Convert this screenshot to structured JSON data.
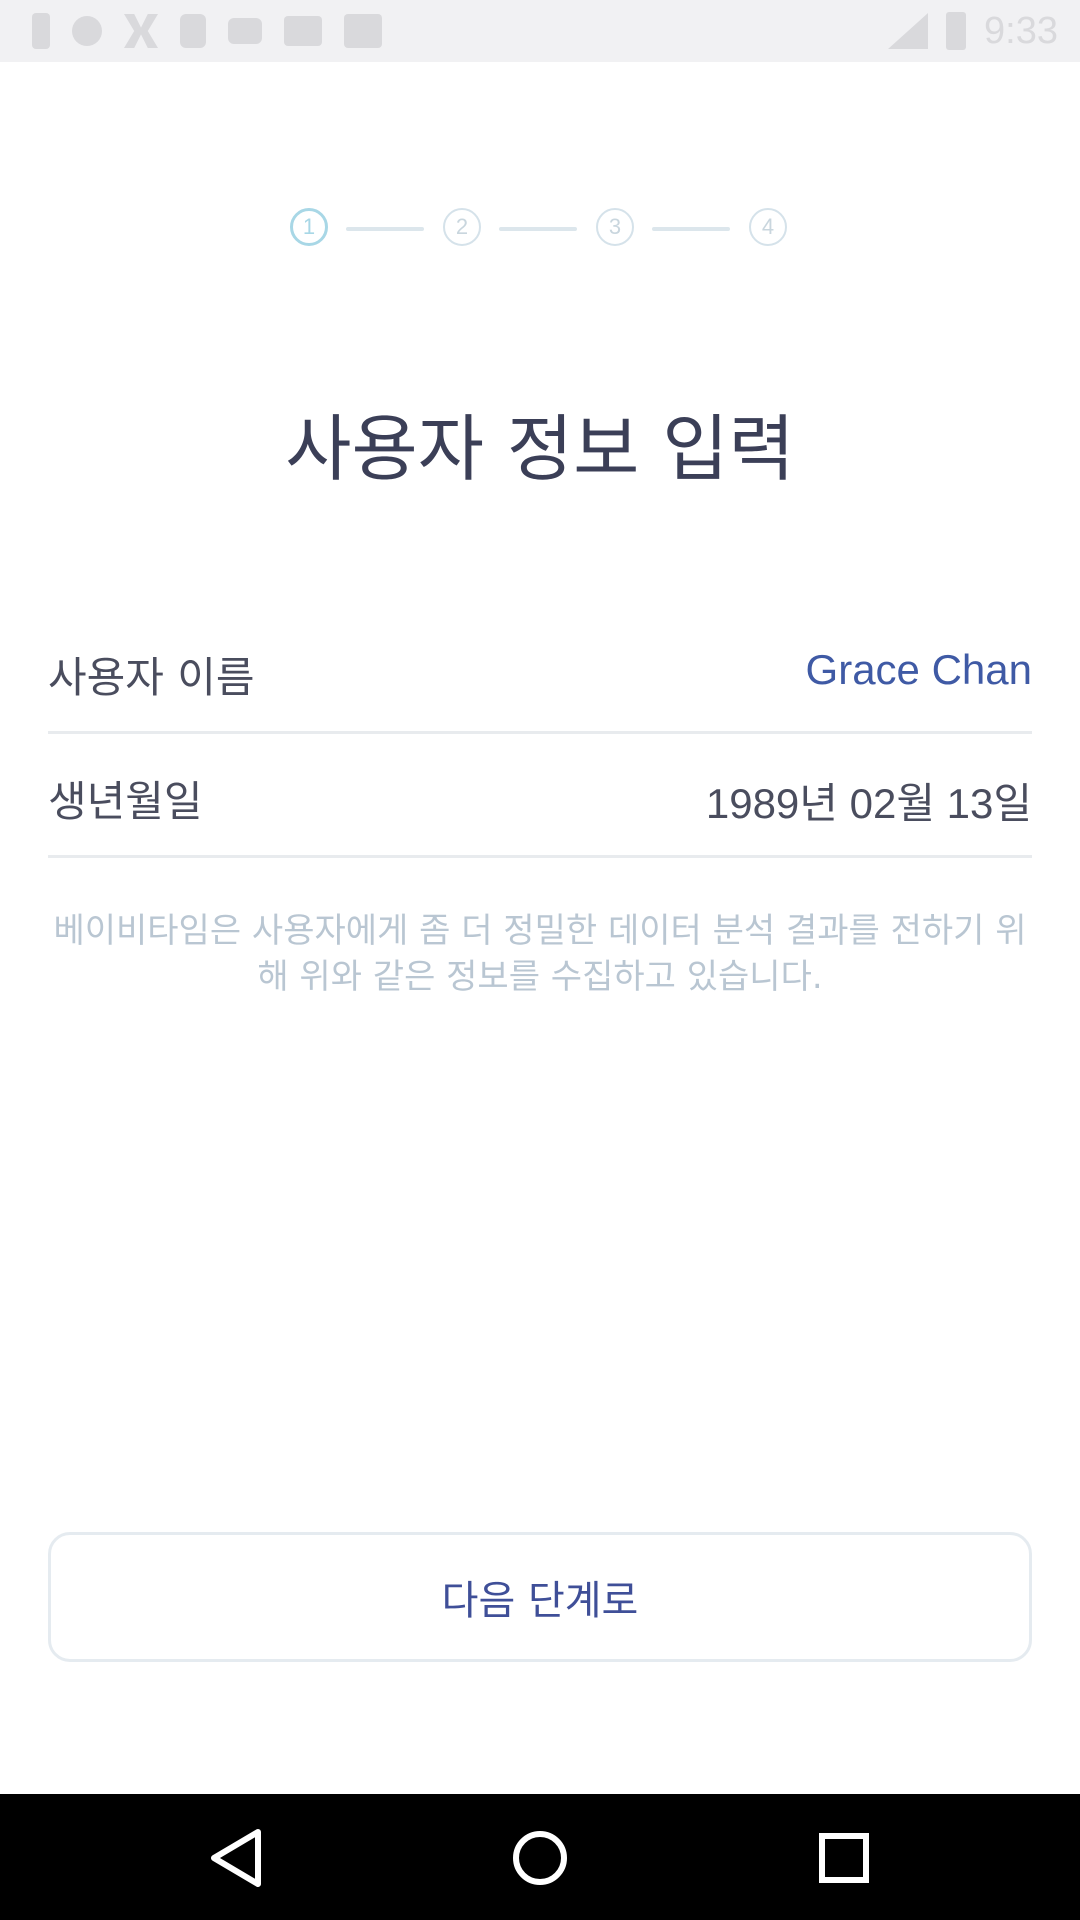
{
  "status_bar": {
    "time": "9:33"
  },
  "stepper": {
    "steps": [
      "1",
      "2",
      "3",
      "4"
    ],
    "active_step": 1
  },
  "page": {
    "title": "사용자 정보 입력"
  },
  "form": {
    "name_label": "사용자 이름",
    "name_value": "Grace Chan",
    "birth_label": "생년월일",
    "birth_value": "1989년 02월 13일"
  },
  "notice": {
    "text": "베이비타임은 사용자에게 좀 더 정밀한 데이터 분석 결과를 전하기 위해 위와 같은 정보를 수집하고 있습니다."
  },
  "actions": {
    "next_label": "다음 단계로"
  },
  "nav_bar": {
    "icons": [
      "back-icon",
      "home-icon",
      "recent-apps-icon"
    ]
  },
  "colors": {
    "accent": "#3f5aa5",
    "title": "#3b3f57",
    "step_active": "#a8d7e6",
    "notice": "#b9c6d2"
  }
}
